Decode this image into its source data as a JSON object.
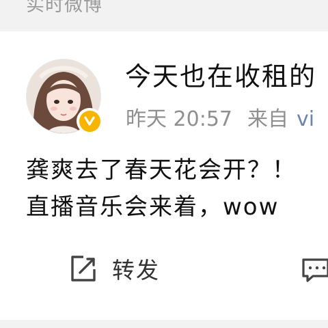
{
  "section_header": {
    "title": "实时微博"
  },
  "post": {
    "username": "今天也在收租的",
    "time_label": "昨天 20:57",
    "source_label": "来自",
    "source_partial": "vi",
    "verified": true,
    "lines": [
      "龚爽去了春天花会开？！",
      "直播音乐会来着，wow"
    ]
  },
  "actions": {
    "repost_label": "转发",
    "repost_icon": "repost-icon",
    "comment_icon": "comment-icon"
  },
  "colors": {
    "background": "#f2f2f2",
    "card": "#ffffff",
    "verified_badge": "#f7b500",
    "source_link": "#6b84b2",
    "meta_text": "#8f8f8f"
  }
}
